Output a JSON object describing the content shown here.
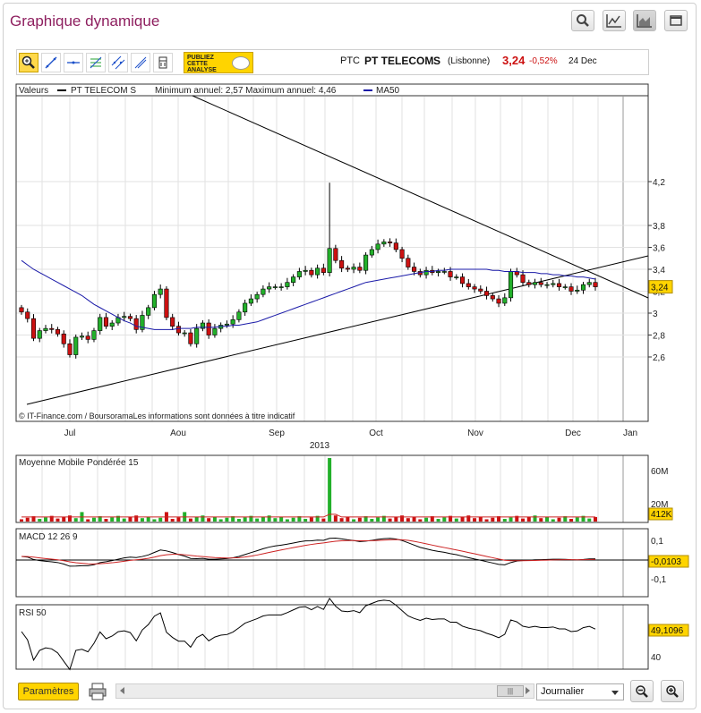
{
  "header": {
    "title": "Graphique dynamique",
    "buttons": [
      "search-icon",
      "line-chart-icon",
      "area-chart-icon",
      "maximize-icon"
    ]
  },
  "toolbar": {
    "tools": [
      "zoom-icon",
      "trendline-icon",
      "horizontal-line-icon",
      "fibonacci-icon",
      "channel-icon",
      "parallel-lines-icon",
      "eraser-icon",
      "trash-icon"
    ],
    "publish_lines": [
      "PUBLIEZ",
      "CETTE",
      "ANALYSE"
    ]
  },
  "quote": {
    "ticker": "PTC",
    "name": "PT TELECOM",
    "suffix": "S",
    "market": "(Lisbonne)",
    "price": "3,24",
    "change": "-0,52%",
    "date": "24 Dec"
  },
  "colors": {
    "up": "#22b02a",
    "down": "#cc1111",
    "ma": "#1a1aa8",
    "signal": "#cc2222",
    "accent": "#8e1f5f",
    "badge": "#ffd400"
  },
  "chart_data": [
    {
      "type": "candlestick",
      "legend_prefix": "Valeurs",
      "series_name": "PT TELECOM  S",
      "stats_text": "Minimum annuel: 2,57 Maximum annuel: 4,46",
      "ma_name": "MA50",
      "x_ticks": [
        "Jul",
        "Aou",
        "Sep",
        "Oct",
        "Nov",
        "Dec",
        "Jan"
      ],
      "year_label": "2013",
      "y_ticks": [
        2.6,
        2.8,
        3,
        3.2,
        3.4,
        3.6,
        3.8,
        4.2
      ],
      "y_tick_labels": [
        "2,6",
        "2,8",
        "3",
        "3,2",
        "3,4",
        "3,6",
        "3,8",
        "4,2"
      ],
      "last_value": "3,24",
      "credit": "© IT-Finance.com / BoursoramaLes informations sont données à titre indicatif",
      "close": [
        3.01,
        2.95,
        2.77,
        2.84,
        2.86,
        2.85,
        2.81,
        2.72,
        2.62,
        2.78,
        2.79,
        2.76,
        2.84,
        2.96,
        2.88,
        2.91,
        2.96,
        2.97,
        2.95,
        2.85,
        2.98,
        3.05,
        3.17,
        3.22,
        2.96,
        2.88,
        2.82,
        2.82,
        2.72,
        2.86,
        2.91,
        2.8,
        2.86,
        2.89,
        2.9,
        2.94,
        3.01,
        3.09,
        3.13,
        3.17,
        3.22,
        3.24,
        3.24,
        3.24,
        3.28,
        3.33,
        3.38,
        3.39,
        3.35,
        3.41,
        3.37,
        3.59,
        3.48,
        3.41,
        3.4,
        3.42,
        3.39,
        3.53,
        3.58,
        3.63,
        3.65,
        3.64,
        3.58,
        3.5,
        3.42,
        3.38,
        3.35,
        3.39,
        3.37,
        3.38,
        3.38,
        3.33,
        3.33,
        3.27,
        3.24,
        3.22,
        3.2,
        3.16,
        3.13,
        3.09,
        3.14,
        3.38,
        3.35,
        3.28,
        3.26,
        3.28,
        3.26,
        3.26,
        3.27,
        3.24,
        3.24,
        3.2,
        3.21,
        3.26,
        3.28,
        3.24
      ],
      "ma50": [
        3.48,
        3.44,
        3.4,
        3.37,
        3.34,
        3.31,
        3.28,
        3.25,
        3.22,
        3.19,
        3.16,
        3.12,
        3.08,
        3.05,
        3.02,
        2.99,
        2.96,
        2.93,
        2.91,
        2.88,
        2.87,
        2.86,
        2.85,
        2.85,
        2.85,
        2.85,
        2.86,
        2.86,
        2.86,
        2.87,
        2.87,
        2.87,
        2.87,
        2.88,
        2.88,
        2.89,
        2.89,
        2.9,
        2.91,
        2.92,
        2.94,
        2.96,
        2.98,
        3.0,
        3.02,
        3.04,
        3.06,
        3.08,
        3.1,
        3.12,
        3.14,
        3.16,
        3.18,
        3.2,
        3.22,
        3.24,
        3.26,
        3.28,
        3.29,
        3.3,
        3.31,
        3.32,
        3.33,
        3.34,
        3.35,
        3.36,
        3.37,
        3.38,
        3.38,
        3.39,
        3.39,
        3.4,
        3.4,
        3.4,
        3.4,
        3.4,
        3.4,
        3.4,
        3.39,
        3.39,
        3.38,
        3.38,
        3.38,
        3.37,
        3.37,
        3.37,
        3.36,
        3.36,
        3.35,
        3.35,
        3.34,
        3.34,
        3.33,
        3.33,
        3.32,
        3.31
      ]
    },
    {
      "type": "bar",
      "title": "Moyenne Mobile Pondérée 15",
      "y_tick_labels": [
        "60M",
        "20M"
      ],
      "last_value": "412K",
      "peak_value_millions": 67,
      "typical_value_millions": 4
    },
    {
      "type": "line",
      "title": "MACD 12 26 9",
      "y_tick_labels": [
        "0,1",
        "-0,1"
      ],
      "last_value": "-0,0103"
    },
    {
      "type": "line",
      "title": "RSI 50",
      "y_tick_labels": [
        "40"
      ],
      "last_value": "49,1096"
    }
  ],
  "bottom": {
    "params_label": "Paramètres",
    "period_value": "Journalier"
  }
}
